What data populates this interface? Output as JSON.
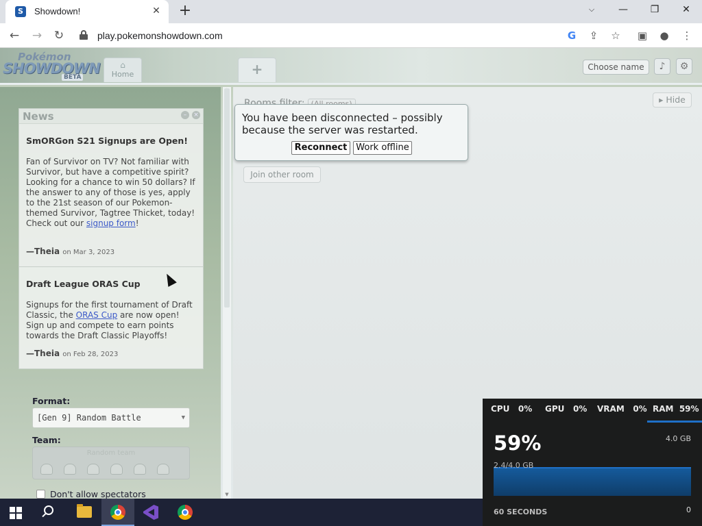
{
  "browser": {
    "tab_title": "Showdown!",
    "tab_favicon": "S",
    "url": "play.pokemonshowdown.com",
    "icons": {
      "tab_close": "close-icon",
      "new_tab": "plus-icon",
      "minimize": "minimize-icon",
      "restore": "restore-icon",
      "close_window": "close-icon",
      "tab_search": "chevron-down-icon",
      "back": "back-arrow-icon",
      "forward": "forward-arrow-icon",
      "reload": "reload-icon",
      "lock": "lock-icon",
      "google": "google-icon",
      "share": "share-icon",
      "bookmark": "star-icon",
      "sidepanel": "side-panel-icon",
      "profile": "profile-icon",
      "menu": "kebab-menu-icon"
    }
  },
  "header": {
    "logo_top": "Pokémon",
    "logo_main": "SHOWDOWN",
    "logo_beta": "BETA",
    "home_tab": "Home",
    "new_tab": "+",
    "choose_name": "Choose name",
    "sound_icon": "volume-icon",
    "settings_icon": "gear-icon"
  },
  "news": {
    "title": "News",
    "items": [
      {
        "headline": "SmORGon S21 Signups are Open!",
        "body_before_link": "Fan of Survivor on TV? Not familiar with Survivor, but have a competitive spirit? Looking for a chance to win 50 dollars? If the answer to any of those is yes, apply to the 21st season of our Pokemon-themed Survivor, Tagtree Thicket, today! Check out our ",
        "link_text": "signup form",
        "body_after_link": "!",
        "author": "—Theia",
        "date": "on Mar 3, 2023"
      },
      {
        "headline": "Draft League ORAS Cup",
        "body_before_link": "Signups for the first tournament of Draft Classic, the ",
        "link_text": "ORAS Cup",
        "body_after_link": " are now open! Sign up and compete to earn points towards the Draft Classic Playoffs!",
        "author": "—Theia",
        "date": "on Feb 28, 2023"
      }
    ]
  },
  "battle_form": {
    "format_label": "Format:",
    "format_value": "[Gen 9] Random Battle",
    "team_label": "Team:",
    "team_text": "Random team",
    "spectators_label": "Don't allow spectators"
  },
  "main": {
    "rooms_filter_label": "Rooms filter:",
    "rooms_filter_value": "(All rooms)",
    "hide_button": "Hide",
    "join_other_room": "Join other room"
  },
  "popup": {
    "message": "You have been disconnected – possibly because the server was restarted.",
    "reconnect": "Reconnect",
    "work_offline": "Work offline"
  },
  "performance": {
    "cpu_label": "CPU",
    "cpu_value": "0%",
    "gpu_label": "GPU",
    "gpu_value": "0%",
    "vram_label": "VRAM",
    "vram_value": "0%",
    "ram_label": "RAM",
    "ram_value": "59%",
    "big_value": "59%",
    "max_label": "4.0 GB",
    "used_label": "2.4/4.0 GB",
    "time_label": "60 SECONDS",
    "zero_label": "0",
    "accent_color": "#1f70c8"
  },
  "taskbar": {
    "icons": [
      "windows-start-icon",
      "search-icon",
      "file-explorer-icon",
      "chrome-icon",
      "visual-studio-icon",
      "chrome-canary-icon"
    ]
  }
}
